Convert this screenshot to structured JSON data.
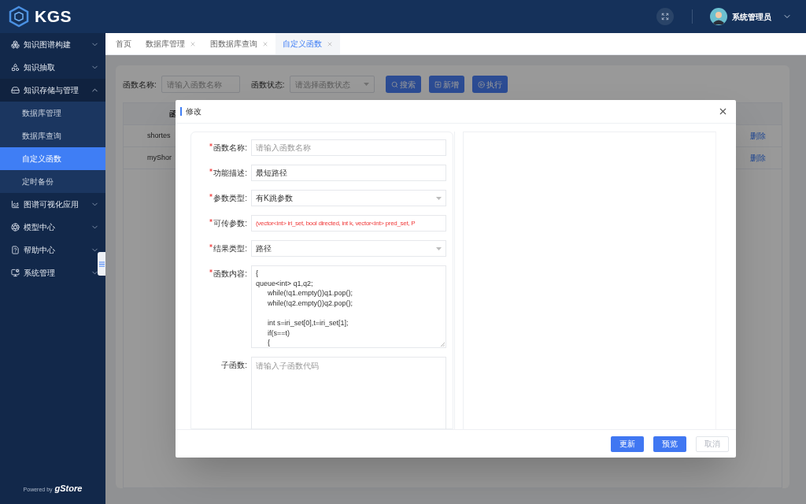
{
  "header": {
    "logo": "KGS",
    "user": "系统管理员"
  },
  "sidebar": {
    "items": [
      {
        "label": "知识图谱构建",
        "expanded": false
      },
      {
        "label": "知识抽取",
        "expanded": false
      },
      {
        "label": "知识存储与管理",
        "expanded": true,
        "children": [
          {
            "label": "数据库管理",
            "selected": false
          },
          {
            "label": "数据库查询",
            "selected": false
          },
          {
            "label": "自定义函数",
            "selected": true
          },
          {
            "label": "定时备份",
            "selected": false
          }
        ]
      },
      {
        "label": "图谱可视化应用",
        "expanded": false
      },
      {
        "label": "模型中心",
        "expanded": false
      },
      {
        "label": "帮助中心",
        "expanded": false
      },
      {
        "label": "系统管理",
        "expanded": false
      }
    ],
    "footer": {
      "powered": "Powered by",
      "brand": "gStore"
    }
  },
  "tabs": [
    {
      "label": "首页",
      "closable": false,
      "selected": false
    },
    {
      "label": "数据库管理",
      "closable": true,
      "selected": false
    },
    {
      "label": "图数据库查询",
      "closable": true,
      "selected": false
    },
    {
      "label": "自定义函数",
      "closable": true,
      "selected": true
    }
  ],
  "filters": [
    {
      "label": "函数名称:",
      "kind": "input",
      "placeholder": "请输入函数名称"
    },
    {
      "label": "函数状态:",
      "kind": "select",
      "placeholder": "请选择函数状态"
    }
  ],
  "actions": [
    {
      "label": "搜索",
      "kind": "search"
    },
    {
      "label": "新增",
      "kind": "add"
    },
    {
      "label": "执行",
      "kind": "run"
    }
  ],
  "table": {
    "columns": [
      "函"
    ],
    "rows": [
      {
        "cells": [
          "shortes"
        ],
        "action": "删除"
      },
      {
        "cells": [
          "myShor"
        ],
        "action": "删除"
      }
    ]
  },
  "dialog": {
    "title": "修改",
    "fields": [
      {
        "label": "函数名称:",
        "required": true,
        "kind": "input",
        "placeholder": "请输入函数名称",
        "invalid": false
      },
      {
        "label": "功能描述:",
        "required": true,
        "kind": "input",
        "value": "最短路径",
        "invalid": false
      },
      {
        "label": "参数类型:",
        "required": true,
        "kind": "select",
        "value": "有K跳参数",
        "invalid": false
      },
      {
        "label": "可传参数:",
        "required": true,
        "kind": "input",
        "value": "(vector<int> iri_set, bool directed, int k, vector<int> pred_set, P",
        "invalid": true
      },
      {
        "label": "结果类型:",
        "required": true,
        "kind": "select",
        "value": "路径",
        "invalid": false
      },
      {
        "label": "函数内容:",
        "required": true,
        "kind": "code",
        "value": "{\nqueue<int> q1,q2;\n\twhile(!q1.empty())q1.pop();\n\twhile(!q2.empty())q2.pop();\n\n\tint s=iri_set[0],t=iri_set[1];\n\tif(s==t)\n\t{",
        "invalid": false
      },
      {
        "label": "子函数:",
        "required": false,
        "kind": "textarea",
        "placeholder": "请输入子函数代码",
        "invalid": false
      }
    ],
    "buttons": [
      {
        "label": "更新",
        "disabled": false
      },
      {
        "label": "预览",
        "disabled": false
      },
      {
        "label": "取消",
        "disabled": true
      }
    ]
  }
}
